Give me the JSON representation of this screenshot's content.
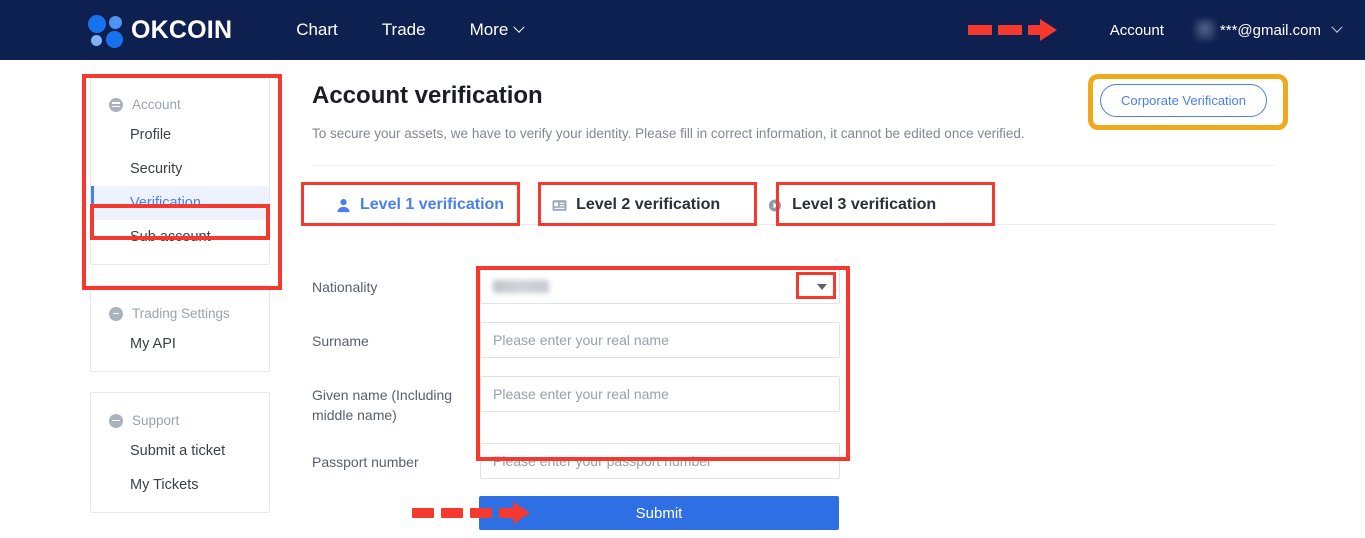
{
  "navbar": {
    "brand": "OKCOIN",
    "logo_icon": "okcoin-dots-logo",
    "links": [
      {
        "label": "Chart",
        "has_caret": false
      },
      {
        "label": "Trade",
        "has_caret": false
      },
      {
        "label": "More",
        "has_caret": true
      }
    ],
    "account_label": "Account",
    "user_email": "***@gmail.com",
    "avatar_icon": "avatar-blurred",
    "caret_icon": "chevron-down-icon",
    "bg_color": "#0e2050"
  },
  "sidebar": {
    "groups": [
      {
        "title": "Account",
        "icon": "account-group-icon",
        "items": [
          {
            "label": "Profile",
            "active": false
          },
          {
            "label": "Security",
            "active": false
          },
          {
            "label": "Verification",
            "active": true
          },
          {
            "label": "Sub account",
            "active": false
          }
        ]
      },
      {
        "title": "Trading Settings",
        "icon": "trading-settings-group-icon",
        "items": [
          {
            "label": "My API",
            "active": false
          }
        ]
      },
      {
        "title": "Support",
        "icon": "support-group-icon",
        "items": [
          {
            "label": "Submit a ticket",
            "active": false
          },
          {
            "label": "My Tickets",
            "active": false
          }
        ]
      }
    ],
    "active_color": "#4a7ef0"
  },
  "main": {
    "title": "Account verification",
    "description": "To secure your assets, we have to verify your identity. Please fill in correct information, it cannot be edited once verified.",
    "corporate_button": "Corporate Verification"
  },
  "tabs": [
    {
      "label": "Level 1 verification",
      "icon": "person-icon",
      "active": true
    },
    {
      "label": "Level 2 verification",
      "icon": "id-card-icon",
      "active": false
    },
    {
      "label": "Level 3 verification",
      "icon": "video-icon",
      "active": false
    }
  ],
  "form": {
    "fields": [
      {
        "label": "Nationality",
        "type": "select",
        "value": "",
        "value_redacted": true,
        "placeholder": ""
      },
      {
        "label": "Surname",
        "type": "text",
        "value": "",
        "placeholder": "Please enter your real name"
      },
      {
        "label": "Given name (Including middle name)",
        "type": "text",
        "value": "",
        "placeholder": "Please enter your real name"
      },
      {
        "label": "Passport number",
        "type": "text",
        "value": "",
        "placeholder": "Please enter your passport number"
      }
    ],
    "submit_label": "Submit",
    "submit_color": "#2f6fe4"
  },
  "annotations": {
    "red_color": "#f5392e",
    "orange_color": "#f0a91d"
  }
}
